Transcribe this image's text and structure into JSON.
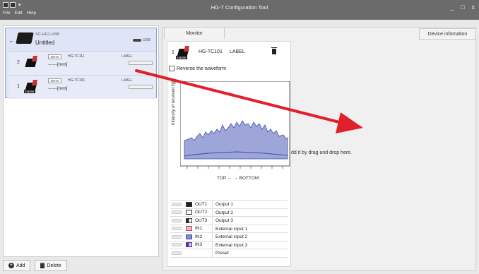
{
  "titlebar": {
    "title": "HG-T Configuration Tool",
    "menu": [
      "File",
      "Edit",
      "Help"
    ],
    "controls": [
      "_",
      "□",
      "x"
    ]
  },
  "left": {
    "group": {
      "model": "SC-HG1-USB",
      "name": "Untitled",
      "connection": "USB"
    },
    "units": [
      {
        "index": "2",
        "range": "10mm",
        "model": "HG-TC111",
        "reading": "------[mm]",
        "label": "LABEL",
        "tag": ""
      },
      {
        "index": "1",
        "range": "10mm",
        "model": "HG-TC101",
        "reading": "------[mm]",
        "label": "LABEL",
        "tag": "master"
      }
    ],
    "buttons": {
      "add": "Add",
      "delete": "Delete"
    }
  },
  "right": {
    "tabs": {
      "monitor": "Monitor",
      "device": "Device infomation"
    },
    "card": {
      "index": "1",
      "model": "HG-TC101",
      "label": "LABEL",
      "sensor_tag": "master",
      "reverse": "Reverse the waveform",
      "ylabel": "Intensity of received light",
      "xlabel": "TOP ← → BOTTOM"
    },
    "legend": [
      {
        "code": "OUT1",
        "desc": "Output 1",
        "icon": "filled-black"
      },
      {
        "code": "OUT2",
        "desc": "Output 2",
        "icon": "outline"
      },
      {
        "code": "OUT3",
        "desc": "Output 3",
        "icon": "half-black"
      },
      {
        "code": "IN1",
        "desc": "External input 1",
        "icon": "pink"
      },
      {
        "code": "IN2",
        "desc": "External input 2",
        "icon": "blue"
      },
      {
        "code": "IN3",
        "desc": "External input 3",
        "icon": "purple"
      },
      {
        "code": "",
        "desc": "Preset",
        "icon": "none"
      }
    ],
    "hint": "dd it by drag and drop here."
  },
  "colors": {
    "accent": "#3b5bab",
    "arrow": "#e0202a",
    "wave_fill": "#9ea6d9",
    "wave_line": "#3a4ca8"
  }
}
